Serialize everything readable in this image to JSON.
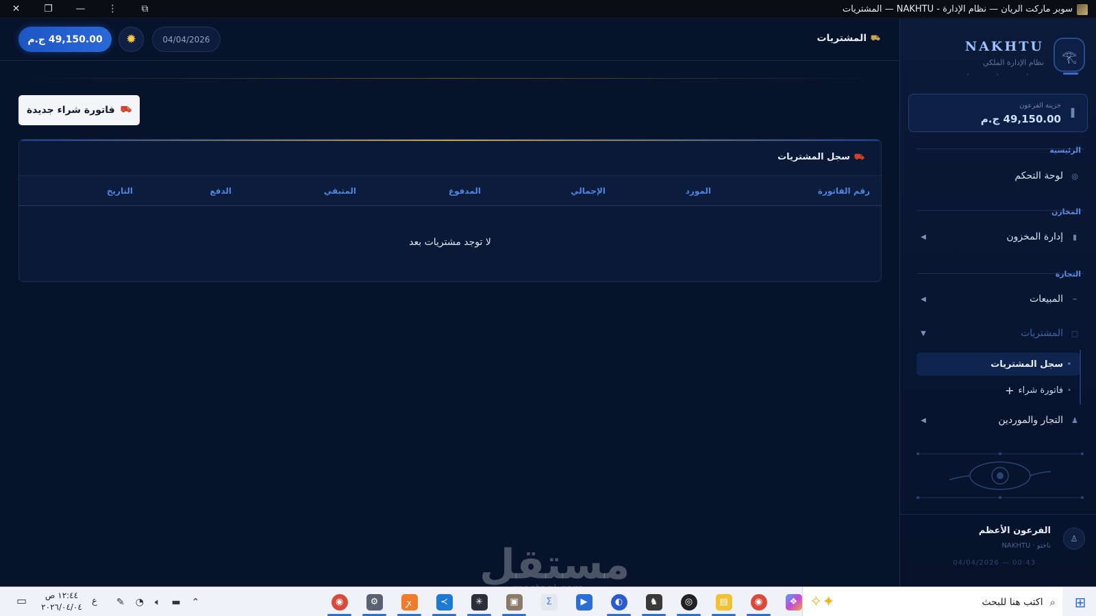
{
  "window": {
    "title": "سوبر ماركت الريان — نظام الإدارة - NAKHTU — المشتريات"
  },
  "brand": {
    "name": "NAKHTU",
    "subtitle": "نظام الإدارة الملكي"
  },
  "treasury": {
    "label": "خزينة الفرعون",
    "amount": "49,150.00 ج.م"
  },
  "sidebar": {
    "sections": [
      {
        "label": "الرئيسية",
        "items": [
          {
            "label": "لوحة التحكم"
          }
        ]
      },
      {
        "label": "المخازن",
        "items": [
          {
            "label": "إدارة المخزون"
          }
        ]
      },
      {
        "label": "التجارة",
        "items": [
          {
            "label": "المبيعات"
          },
          {
            "label": "المشتريات",
            "expanded": true,
            "children": [
              {
                "label": "سجل المشتريات",
                "active": true
              },
              {
                "label": "فاتورة شراء"
              }
            ]
          },
          {
            "label": "التجار والموردين"
          }
        ]
      }
    ]
  },
  "profile": {
    "name": "الفرعون الأعظم",
    "role": "ناختو · NAKHTU",
    "timestamp": "04/04/2026 — 00:43"
  },
  "header": {
    "title": "المشتريات",
    "date": "04/04/2026",
    "amount": "49,150.00 ج.م"
  },
  "main": {
    "new_invoice_button": "فاتورة شراء جديدة",
    "card_title": "سجل المشتريات",
    "columns": [
      "رقم الفاتورة",
      "المورد",
      "الإجمالي",
      "المدفوع",
      "المتبقي",
      "الدفع",
      "التاريخ"
    ],
    "empty_message": "لا توجد مشتريات بعد"
  },
  "watermark": {
    "text": "مستقل",
    "sub": "mostaql.com"
  },
  "taskbar": {
    "search_placeholder": "اكتب هنا للبحث",
    "time": "١٢:٤٤ ص",
    "date": "٢٠٢٦/٠٤/٠٤",
    "language": "ع"
  },
  "colors": {
    "accent": "#2a68d8",
    "gold": "#c4a253",
    "background": "#07132a"
  }
}
